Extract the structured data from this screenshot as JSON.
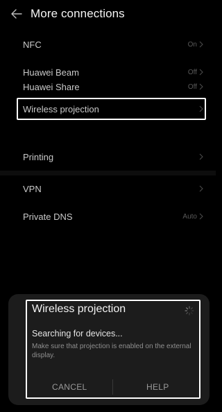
{
  "header": {
    "back_icon": "back-arrow-icon",
    "title": "More connections"
  },
  "settings": [
    {
      "label": "NFC",
      "value": "On"
    },
    {
      "label": "Huawei Beam",
      "value": "Off"
    },
    {
      "label": "Huawei Share",
      "value": "Off"
    },
    {
      "label": "Wireless projection",
      "value": ""
    },
    {
      "label": "Printing",
      "value": ""
    },
    {
      "label": "VPN",
      "value": ""
    },
    {
      "label": "Private DNS",
      "value": "Auto"
    }
  ],
  "dialog": {
    "title": "Wireless projection",
    "status": "Searching for devices...",
    "hint": "Make sure that projection is enabled on the external display.",
    "cancel_label": "CANCEL",
    "help_label": "HELP",
    "spinner_icon": "loading-spinner-icon"
  },
  "colors": {
    "background": "#000000",
    "dialog_background": "#1c1c1c",
    "label": "#c9c9c9",
    "secondary": "#5a5a5a",
    "highlight": "#ffffff"
  }
}
